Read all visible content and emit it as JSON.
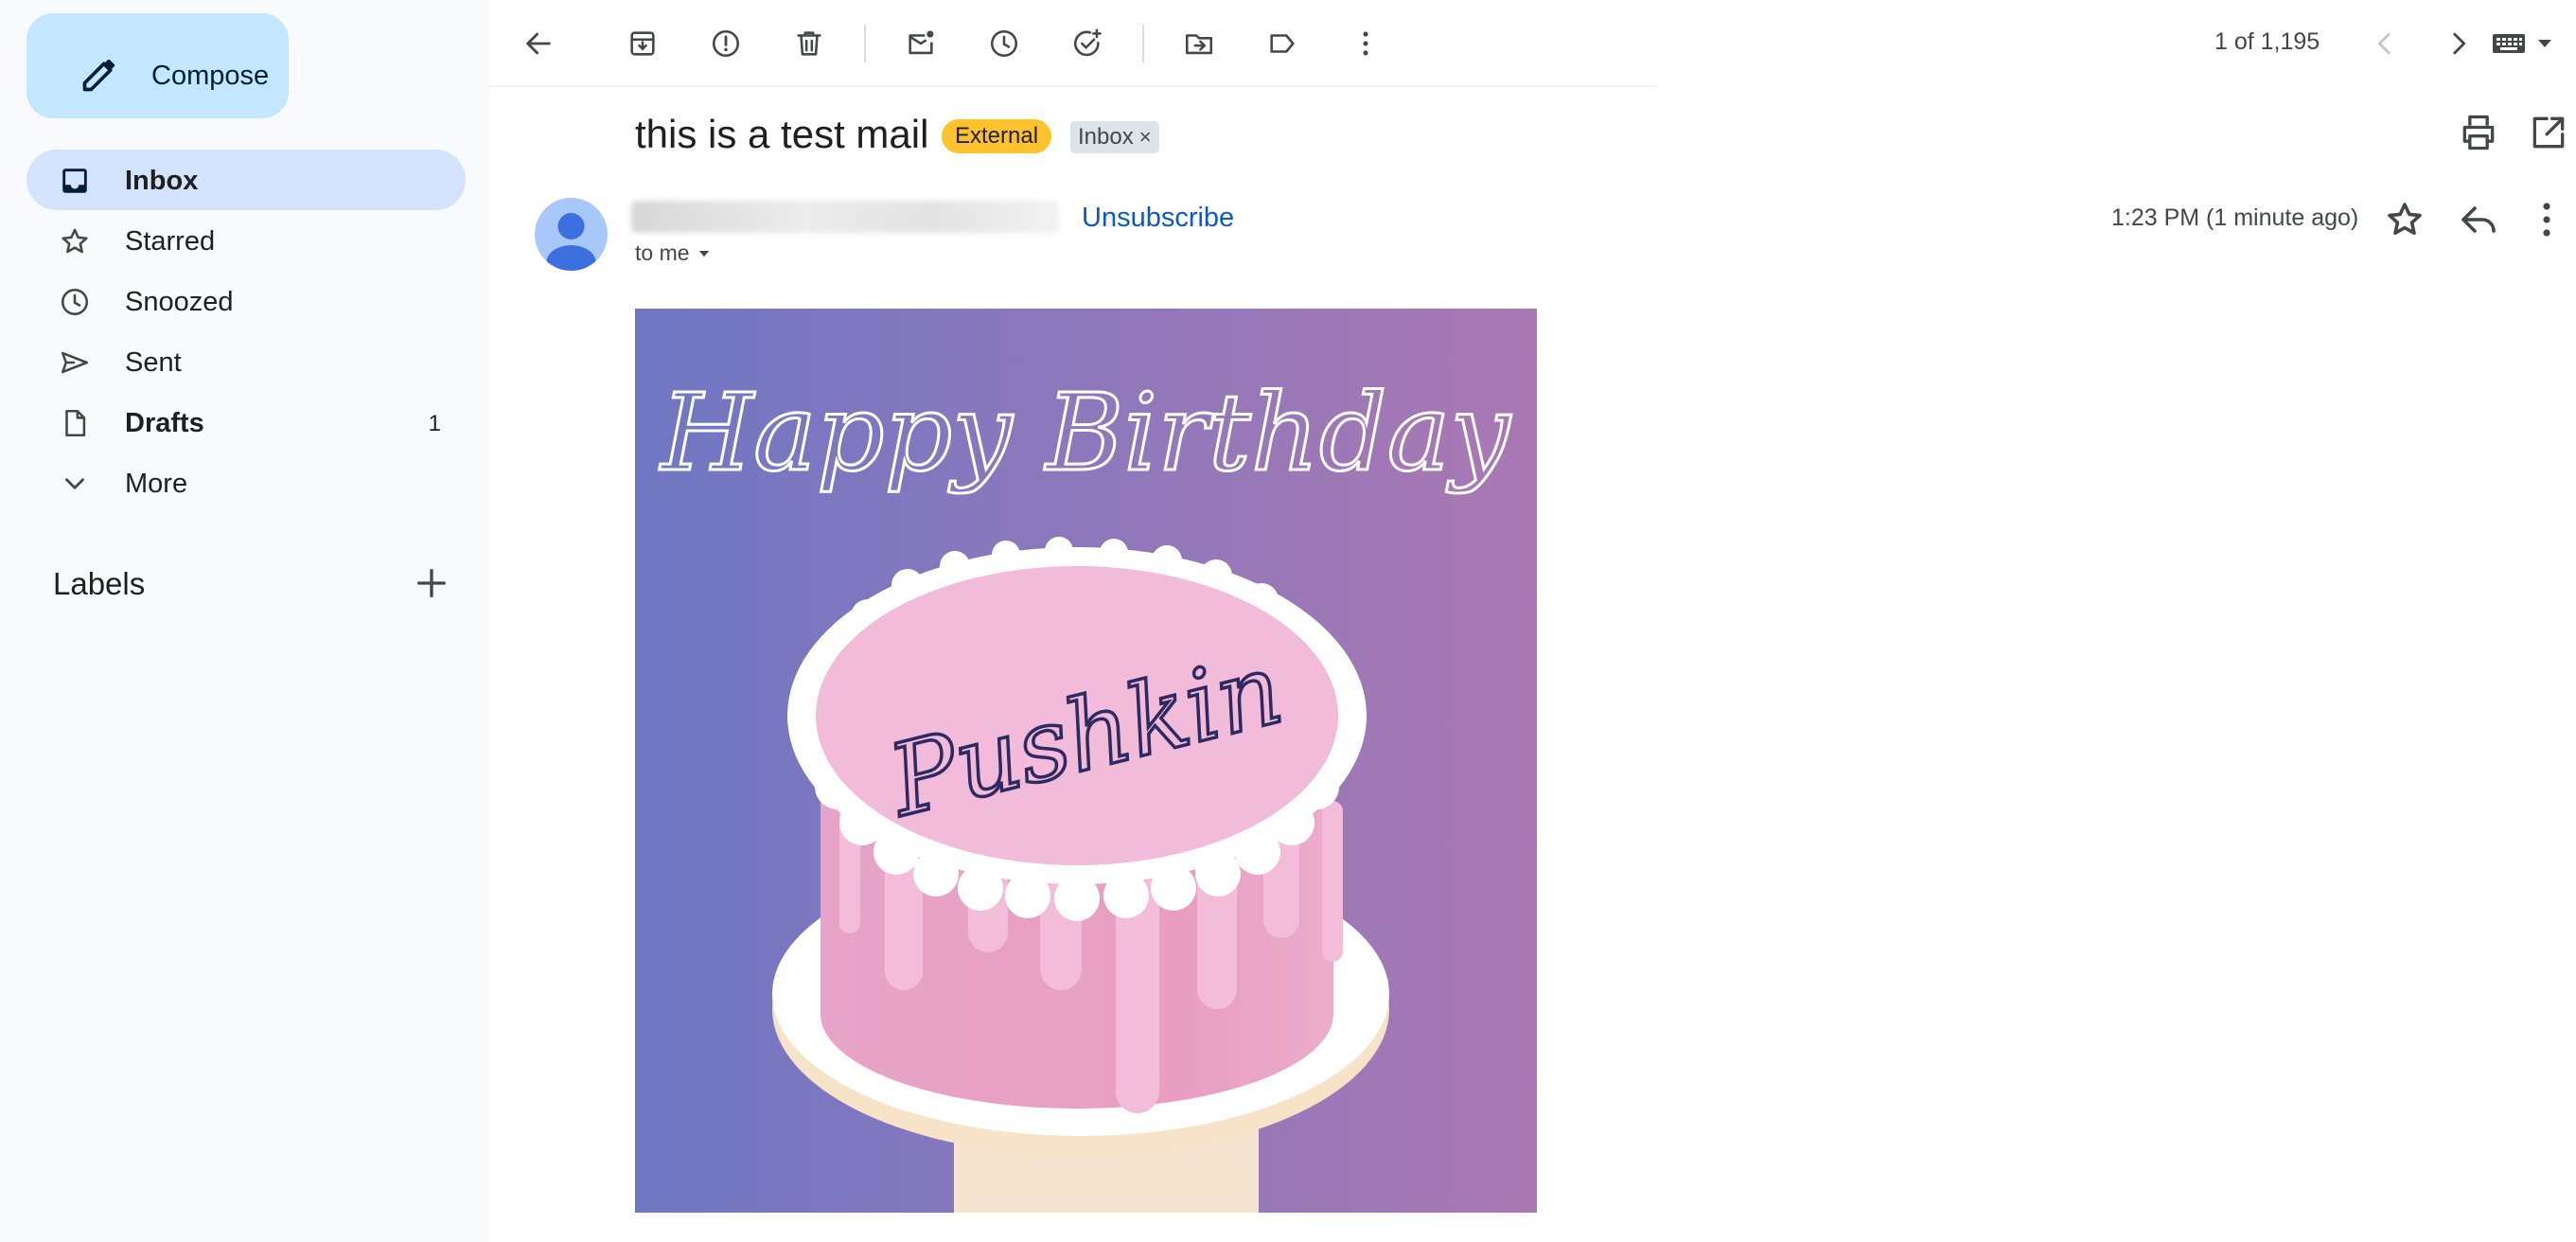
{
  "sidebar": {
    "compose_label": "Compose",
    "items": [
      {
        "label": "Inbox",
        "icon": "inbox-icon",
        "active": true,
        "bold": true,
        "count": ""
      },
      {
        "label": "Starred",
        "icon": "star-icon",
        "active": false,
        "bold": false,
        "count": ""
      },
      {
        "label": "Snoozed",
        "icon": "clock-icon",
        "active": false,
        "bold": false,
        "count": ""
      },
      {
        "label": "Sent",
        "icon": "send-icon",
        "active": false,
        "bold": false,
        "count": ""
      },
      {
        "label": "Drafts",
        "icon": "draft-icon",
        "active": false,
        "bold": true,
        "count": "1"
      },
      {
        "label": "More",
        "icon": "chevron-down-icon",
        "active": false,
        "bold": false,
        "count": ""
      }
    ],
    "labels_heading": "Labels"
  },
  "toolbar": {
    "pager_text": "1 of 1,195",
    "icons": [
      "back-arrow-icon",
      "archive-icon",
      "report-spam-icon",
      "delete-icon",
      "mark-unread-icon",
      "snooze-icon",
      "add-task-icon",
      "move-to-icon",
      "label-icon",
      "more-vert-icon",
      "prev-icon",
      "next-icon",
      "keyboard-icon"
    ]
  },
  "message": {
    "subject": "this is a test mail",
    "badge_external": "External",
    "badge_inbox": "Inbox",
    "unsubscribe": "Unsubscribe",
    "to_me": "to me",
    "timestamp": "1:23 PM (1 minute ago)"
  },
  "card": {
    "headline": "Happy Birthday",
    "name": "Pushkin"
  },
  "colors": {
    "sidebar_bg": "#f8fafd",
    "compose_bg": "#c2e7ff",
    "active_nav_bg": "#d3e3fd",
    "external_badge": "#fdc22d",
    "link_blue": "#0b57d0",
    "card_gradient_left": "#6f77c3",
    "card_gradient_right": "#ab78b3",
    "cake_pink": "#e9a2c5"
  }
}
